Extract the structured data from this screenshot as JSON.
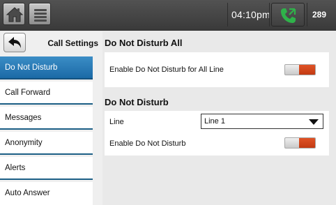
{
  "topbar": {
    "home_icon": "home-icon",
    "menu_icon": "menu-icon",
    "time": "04:10pm",
    "phone_icon": "phone-icon",
    "extension": "289",
    "accent_color": "#2fb24a"
  },
  "sidebar": {
    "back_icon": "back-arrow-icon",
    "title": "Call Settings",
    "items": [
      {
        "label": "Do Not Disturb",
        "active": true
      },
      {
        "label": "Call Forward",
        "active": false
      },
      {
        "label": "Messages",
        "active": false
      },
      {
        "label": "Anonymity",
        "active": false
      },
      {
        "label": "Alerts",
        "active": false
      },
      {
        "label": "Auto Answer",
        "active": false
      }
    ],
    "active_color": "#2a7bb8"
  },
  "main": {
    "dnd_all": {
      "title": "Do Not Disturb All",
      "row_label": "Enable Do Not Disturb for All Line",
      "toggle_on": true
    },
    "dnd": {
      "title": "Do Not Disturb",
      "line_label": "Line",
      "line_value": "Line 1",
      "enable_label": "Enable Do Not Disturb",
      "toggle_on": true
    },
    "toggle_color": "#d24a1c"
  }
}
